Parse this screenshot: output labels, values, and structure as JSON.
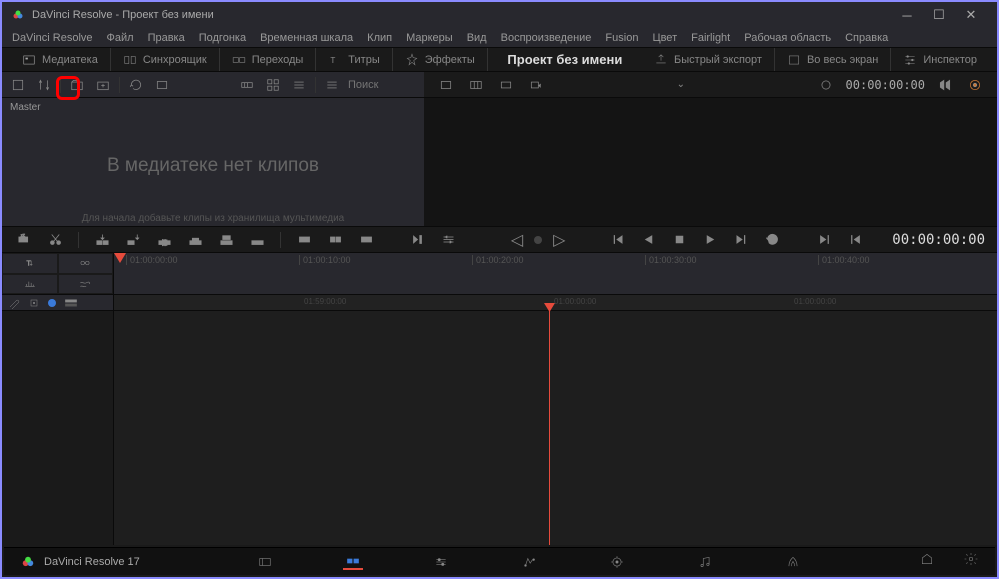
{
  "window": {
    "title": "DaVinci Resolve - Проект без имени"
  },
  "menu": [
    "DaVinci Resolve",
    "Файл",
    "Правка",
    "Подгонка",
    "Временная шкала",
    "Клип",
    "Маркеры",
    "Вид",
    "Воспроизведение",
    "Fusion",
    "Цвет",
    "Fairlight",
    "Рабочая область",
    "Справка"
  ],
  "wstabs": {
    "media": "Медиатека",
    "sync": "Синхроящик",
    "trans": "Переходы",
    "titles": "Титры",
    "effects": "Эффекты",
    "quick_export": "Быстрый экспорт",
    "fullscreen": "Во весь экран",
    "inspector": "Инспектор"
  },
  "project_title": "Проект без имени",
  "search_placeholder": "Поиск",
  "timecode_small": "00:00:00:00",
  "timecode_big": "00:00:00:00",
  "mediapool": {
    "master": "Master",
    "empty_title": "В медиатеке нет клипов",
    "empty_sub": "Для начала добавьте клипы из хранилища мультимедиа"
  },
  "ruler_upper": [
    "01:00:00:00",
    "01:00:10:00",
    "01:00:20:00",
    "01:00:30:00",
    "01:00:40:00"
  ],
  "ruler_lower": [
    "01:59:00:00",
    "01:00:00:00",
    "01:00:00:00"
  ],
  "bottom": {
    "version": "DaVinci Resolve 17"
  }
}
